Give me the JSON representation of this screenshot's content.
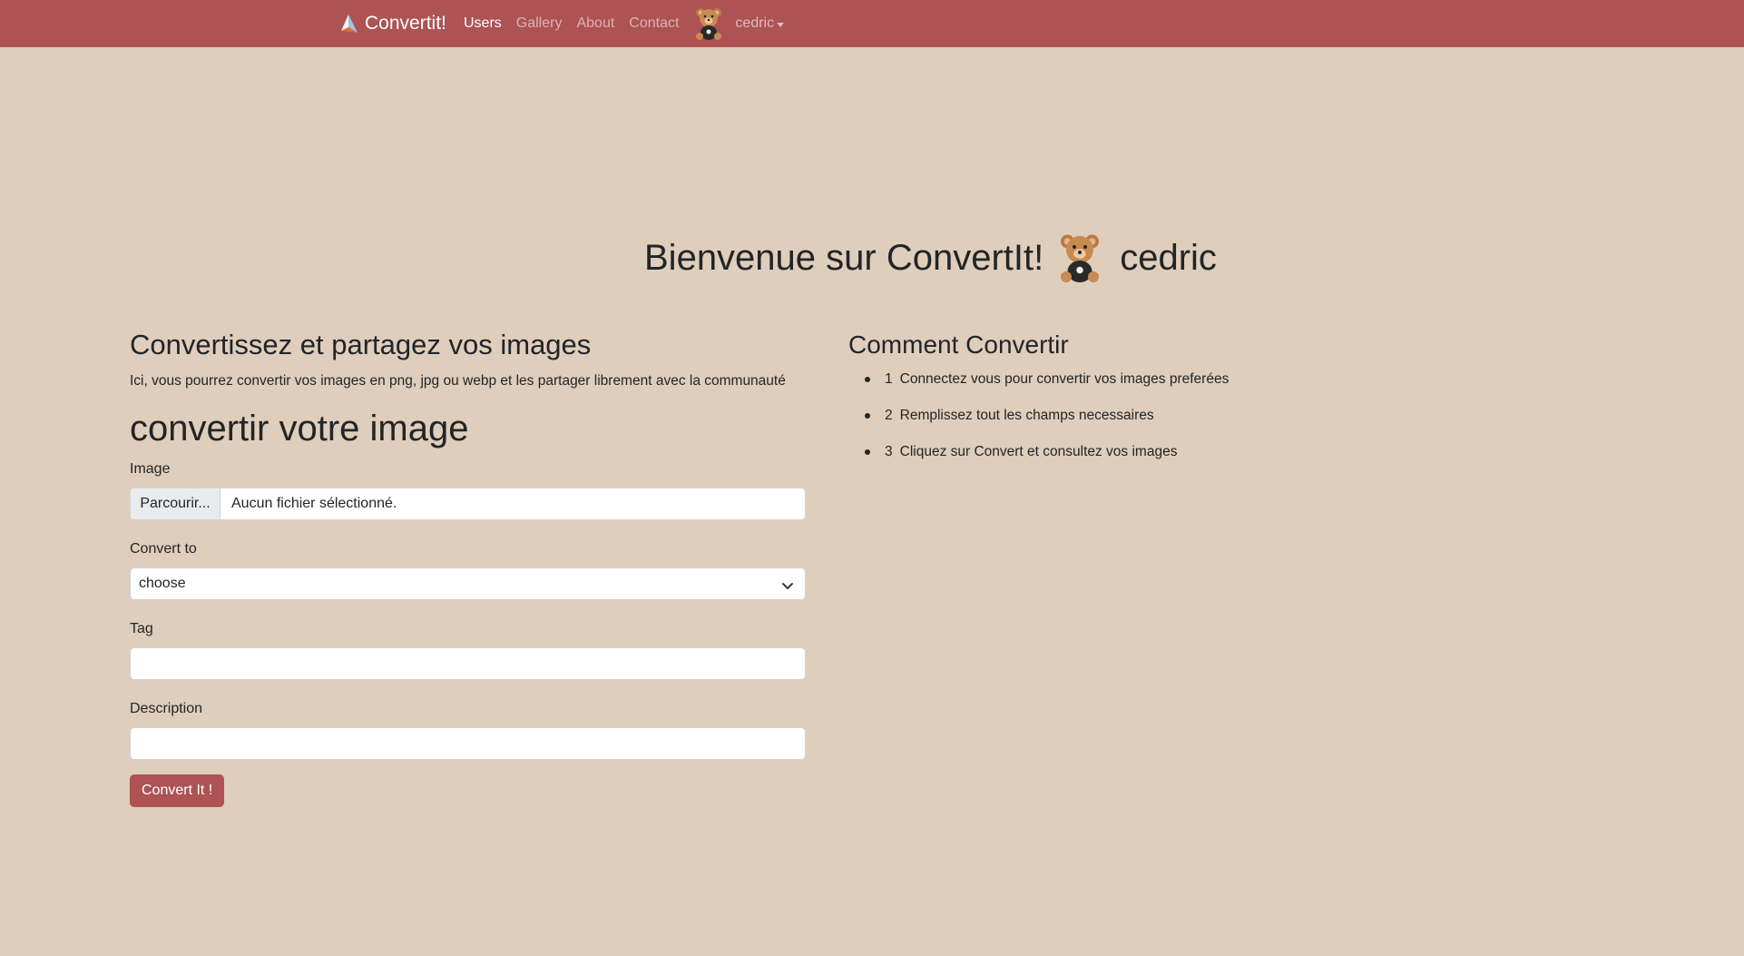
{
  "navbar": {
    "brand": "Convertit!",
    "links": [
      {
        "label": "Users",
        "active": true
      },
      {
        "label": "Gallery",
        "active": false
      },
      {
        "label": "About",
        "active": false
      },
      {
        "label": "Contact",
        "active": false
      }
    ],
    "user": "cedric"
  },
  "welcome": {
    "text": "Bienvenue sur ConvertIt!",
    "username": "cedric"
  },
  "intro": {
    "heading": "Convertissez et partagez vos images",
    "lead": "Ici, vous pourrez convertir vos images en png, jpg ou webp et les partager librement avec la communauté"
  },
  "form": {
    "heading": "convertir votre image",
    "image_label": "Image",
    "file_button": "Parcourir...",
    "file_status": "Aucun fichier sélectionné.",
    "convert_label": "Convert to",
    "convert_selected": "choose",
    "tag_label": "Tag",
    "tag_value": "",
    "description_label": "Description",
    "description_value": "",
    "submit": "Convert It !"
  },
  "howto": {
    "heading": "Comment Convertir",
    "steps": [
      {
        "num": "1",
        "text": "Connectez vous pour convertir vos images preferées"
      },
      {
        "num": "2",
        "text": "Remplissez tout les champs necessaires"
      },
      {
        "num": "3",
        "text": "Cliquez sur Convert et consultez vos images"
      }
    ]
  },
  "colors": {
    "navbar": "#ad5354",
    "background": "#dfcebb",
    "button": "#ad5354"
  },
  "icons": {
    "brand": "paper-plane-logo-icon",
    "avatar": "teddy-bear-icon",
    "select": "chevron-down-icon"
  }
}
